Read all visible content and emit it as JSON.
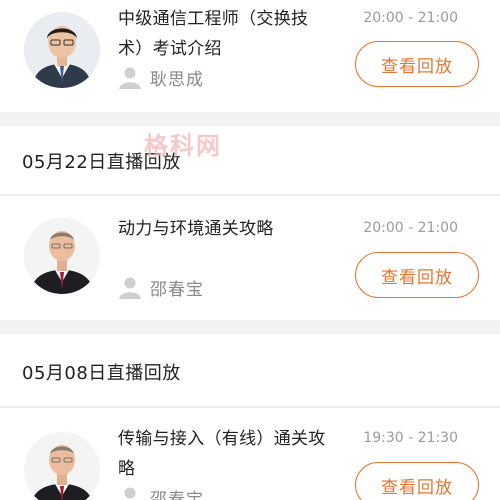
{
  "watermark": "格科网",
  "sections": [
    {
      "header": null,
      "course": {
        "title": "中级通信工程师（交换技术）考试介绍",
        "title_line1": "中级通信工程师（交换技",
        "title_line2": "术）考试介绍",
        "teacher": "耿思成",
        "time": "20:00 - 21:00",
        "button": "查看回放"
      }
    },
    {
      "header": "05月22日直播回放",
      "course": {
        "title": "动力与环境通关攻略",
        "teacher": "邵春宝",
        "time": "20:00 - 21:00",
        "button": "查看回放"
      }
    },
    {
      "header": "05月08日直播回放",
      "course": {
        "title_line1": "传输与接入（有线）通关攻",
        "title_line2": "略",
        "teacher": "邵春宝",
        "time": "19:30 - 21:30",
        "button": "查看回放"
      }
    }
  ],
  "colors": {
    "accent": "#e8742f",
    "background_gap": "#f2f2f2",
    "muted": "#9a9a9a"
  },
  "icons": {
    "teacher": "person-icon"
  }
}
